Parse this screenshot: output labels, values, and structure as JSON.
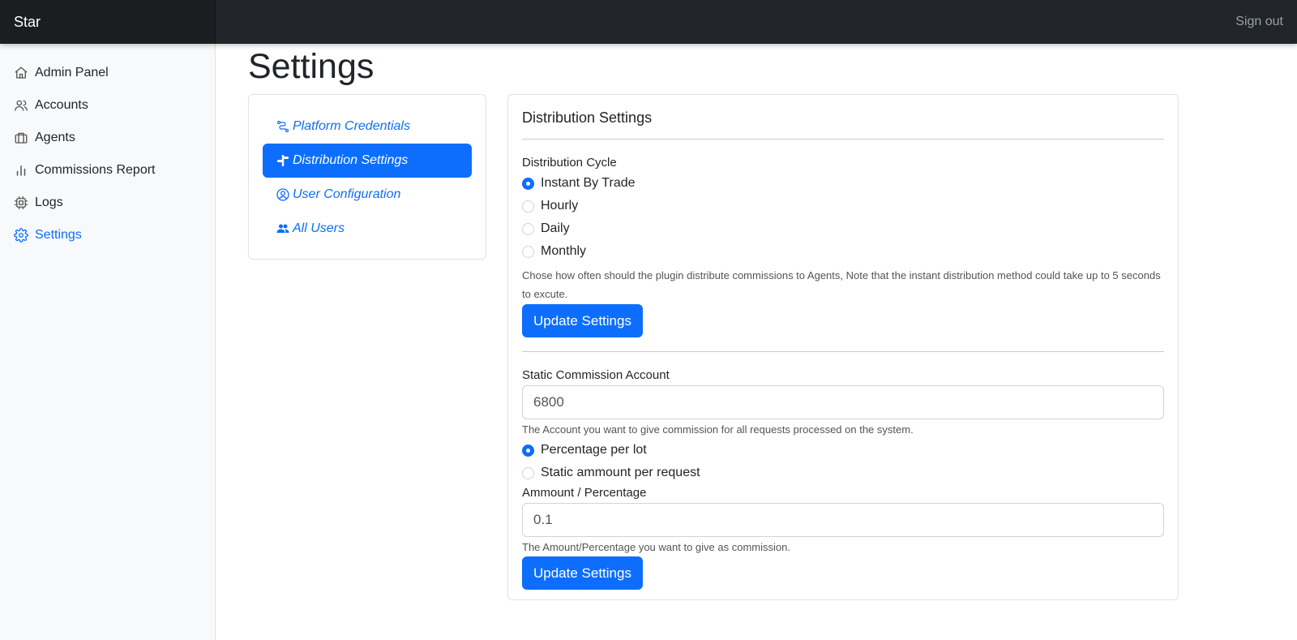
{
  "header": {
    "brand": "Star",
    "signout": "Sign out"
  },
  "sidebar": {
    "items": [
      {
        "label": "Admin Panel",
        "icon": "home-icon"
      },
      {
        "label": "Accounts",
        "icon": "users-icon"
      },
      {
        "label": "Agents",
        "icon": "briefcase-icon"
      },
      {
        "label": "Commissions Report",
        "icon": "bar-chart-icon"
      },
      {
        "label": "Logs",
        "icon": "cpu-icon"
      },
      {
        "label": "Settings",
        "icon": "gear-icon",
        "active": true
      }
    ]
  },
  "page": {
    "title": "Settings"
  },
  "subnav": {
    "items": [
      {
        "label": "Platform Credentials",
        "icon": "route-icon"
      },
      {
        "label": "Distribution Settings",
        "icon": "signpost-icon",
        "active": true
      },
      {
        "label": "User Configuration",
        "icon": "user-circle-icon"
      },
      {
        "label": "All Users",
        "icon": "people-icon"
      }
    ]
  },
  "card": {
    "title": "Distribution Settings",
    "cycle": {
      "label": "Distribution Cycle",
      "options": [
        "Instant By Trade",
        "Hourly",
        "Daily",
        "Monthly"
      ],
      "selected": "Instant By Trade",
      "help": "Chose how often should the plugin distribute commissions to Agents, Note that the instant distribution method could take up to 5 seconds to excute.",
      "button": "Update Settings"
    },
    "commission": {
      "account_label": "Static Commission Account",
      "account_value": "6800",
      "account_help": "The Account you want to give commission for all requests processed on the system.",
      "options": [
        "Percentage per lot",
        "Static ammount per request"
      ],
      "selected": "Percentage per lot",
      "amount_label": "Ammount / Percentage",
      "amount_value": "0.1",
      "amount_help": "The Amount/Percentage you want to give as commission.",
      "button": "Update Settings"
    }
  },
  "colors": {
    "primary": "#0d6efd",
    "topbar": "#212529",
    "sidebar": "#f8f9fa"
  }
}
